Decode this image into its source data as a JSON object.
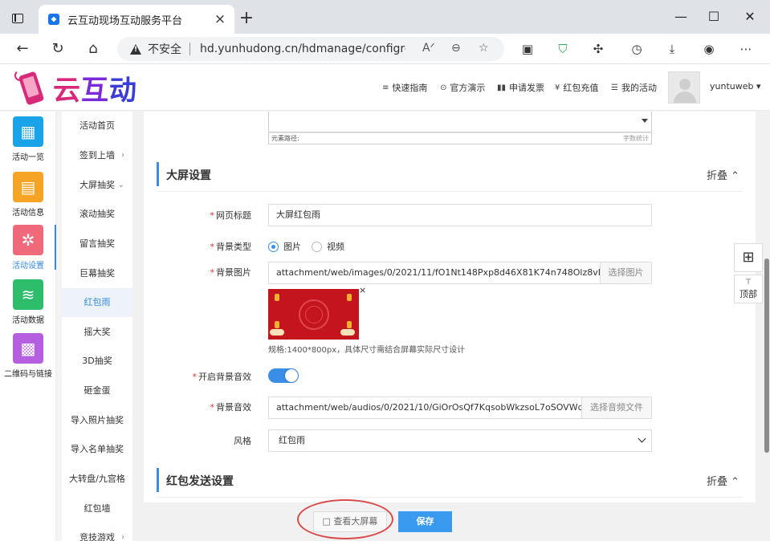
{
  "browser": {
    "tab_title": "云互动现场互动服务平台",
    "insecure_label": "不安全",
    "url": "hd.yunhudong.cn/hdmanage/configred...",
    "new_tab": "+"
  },
  "header": {
    "brand": [
      "云",
      "互",
      "动"
    ],
    "nav": [
      {
        "icon": "≡",
        "label": "快速指南"
      },
      {
        "icon": "⊙",
        "label": "官方演示"
      },
      {
        "icon": "▮▮",
        "label": "申请发票"
      },
      {
        "icon": "¥",
        "label": "红包充值"
      },
      {
        "icon": "☰",
        "label": "我的活动"
      }
    ],
    "username": "yuntuweb",
    "username_caret": "▾"
  },
  "iconbar": [
    {
      "label": "活动一览",
      "color": "#1aa3e8"
    },
    {
      "label": "活动信息",
      "color": "#f5a425"
    },
    {
      "label": "活动设置",
      "color": "#f0697a"
    },
    {
      "label": "活动数据",
      "color": "#2ebd6b"
    },
    {
      "label": "二维码与链接",
      "color": "#b55fe0"
    }
  ],
  "submenu": [
    {
      "label": "活动首页",
      "arrow": ""
    },
    {
      "label": "签到上墙",
      "arrow": "›"
    },
    {
      "label": "大屏抽奖",
      "arrow": "⌄"
    },
    {
      "label": "滚动抽奖",
      "arrow": ""
    },
    {
      "label": "留言抽奖",
      "arrow": ""
    },
    {
      "label": "巨幕抽奖",
      "arrow": ""
    },
    {
      "label": "红包雨",
      "arrow": ""
    },
    {
      "label": "摇大奖",
      "arrow": ""
    },
    {
      "label": "3D抽奖",
      "arrow": ""
    },
    {
      "label": "砸金蛋",
      "arrow": ""
    },
    {
      "label": "导入照片抽奖",
      "arrow": ""
    },
    {
      "label": "导入名单抽奖",
      "arrow": ""
    },
    {
      "label": "大转盘/九宫格",
      "arrow": ""
    },
    {
      "label": "红包墙",
      "arrow": ""
    },
    {
      "label": "竞技游戏",
      "arrow": "›"
    }
  ],
  "prev_editor": {
    "status_left": "元素路径:",
    "status_right": "字数统计"
  },
  "big_screen": {
    "title": "大屏设置",
    "fold": "折叠 ⌃",
    "page_title_label": "网页标题",
    "page_title_value": "大屏红包雨",
    "bg_type_label": "背景类型",
    "bg_type_options": [
      "图片",
      "视频"
    ],
    "bg_image_label": "背景图片",
    "bg_image_path": "attachment/web/images/0/2021/11/fO1Nt148Pxp8d46X81K74n748Olz8vDP.jpg",
    "choose_image": "选择图片",
    "remove": "×",
    "size_hint": "规格:1400*800px，具体尺寸需结合屏幕实际尺寸设计",
    "bg_sound_toggle_label": "开启背景音效",
    "bg_sound_label": "背景音效",
    "bg_sound_path": "attachment/web/audios/0/2021/10/GiOrOsQf7KqsobWkzsoL7oSOVWd3rwWQ,n",
    "choose_audio": "选择音频文件",
    "style_label": "风格",
    "style_value": "红包雨",
    "required_mark": "*"
  },
  "redpacket": {
    "title": "红包发送设置",
    "fold": "折叠 ⌃"
  },
  "float": {
    "top_label": "顶部",
    "top_arrow": "⊤"
  },
  "actions": {
    "view_big_screen": "□ 查看大屏幕",
    "save": "保存"
  }
}
